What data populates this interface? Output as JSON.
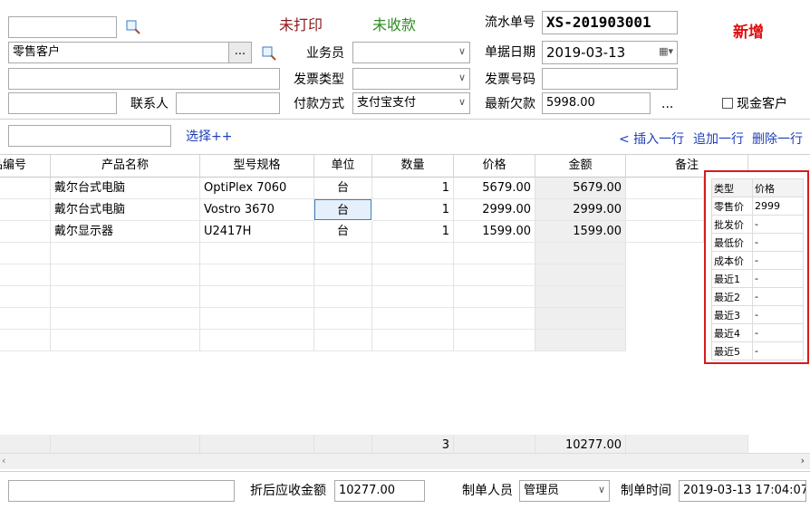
{
  "header": {
    "status_print": "未打印",
    "status_payment": "未收款",
    "status_mode": "新增",
    "customer_name": "零售客户",
    "contact_label": "联系人",
    "salesperson_label": "业务员",
    "invoice_type_label": "发票类型",
    "payment_method_label": "付款方式",
    "payment_method_value": "支付宝支付",
    "serial_label": "流水单号",
    "serial_value": "XS-201903001",
    "date_label": "单据日期",
    "date_value": "2019-03-13",
    "invoice_no_label": "发票号码",
    "latest_debt_label": "最新欠款",
    "latest_debt_value": "5998.00",
    "ellipsis": "...",
    "cash_customer_label": "现金客户",
    "browse_label": "..."
  },
  "toolbar": {
    "select_link": "选择++",
    "insert_row": "< 插入一行",
    "append_row": "追加一行",
    "delete_row": "删除一行"
  },
  "grid": {
    "columns": [
      "品编号",
      "产品名称",
      "型号规格",
      "单位",
      "数量",
      "价格",
      "金额",
      "备注"
    ],
    "rows": [
      {
        "name": "戴尔台式电脑",
        "model": "OptiPlex 7060",
        "unit": "台",
        "qty": "1",
        "price": "5679.00",
        "amount": "5679.00"
      },
      {
        "name": "戴尔台式电脑",
        "model": "Vostro 3670",
        "unit": "台",
        "qty": "1",
        "price": "2999.00",
        "amount": "2999.00"
      },
      {
        "name": "戴尔显示器",
        "model": "U2417H",
        "unit": "台",
        "qty": "1",
        "price": "1599.00",
        "amount": "1599.00"
      }
    ],
    "total_qty": "3",
    "total_amount": "10277.00"
  },
  "price_popup": {
    "headers": [
      "类型",
      "价格"
    ],
    "rows": [
      {
        "type": "零售价",
        "price": "2999"
      },
      {
        "type": "批发价",
        "price": "-"
      },
      {
        "type": "最低价",
        "price": "-"
      },
      {
        "type": "成本价",
        "price": "-"
      },
      {
        "type": "最近1",
        "price": "-"
      },
      {
        "type": "最近2",
        "price": "-"
      },
      {
        "type": "最近3",
        "price": "-"
      },
      {
        "type": "最近4",
        "price": "-"
      },
      {
        "type": "最近5",
        "price": "-"
      }
    ]
  },
  "footer": {
    "discount_label": "折后应收金额",
    "discount_value": "10277.00",
    "creator_label": "制单人员",
    "creator_value": "管理员",
    "created_time_label": "制单时间",
    "created_time_value": "2019-03-13 17:04:07"
  },
  "colors": {
    "status_print": "#8b1a1a",
    "status_payment": "#2e8b22",
    "status_mode": "#e01010",
    "link": "#1f3fb7",
    "popup_border": "#d41c1c"
  }
}
